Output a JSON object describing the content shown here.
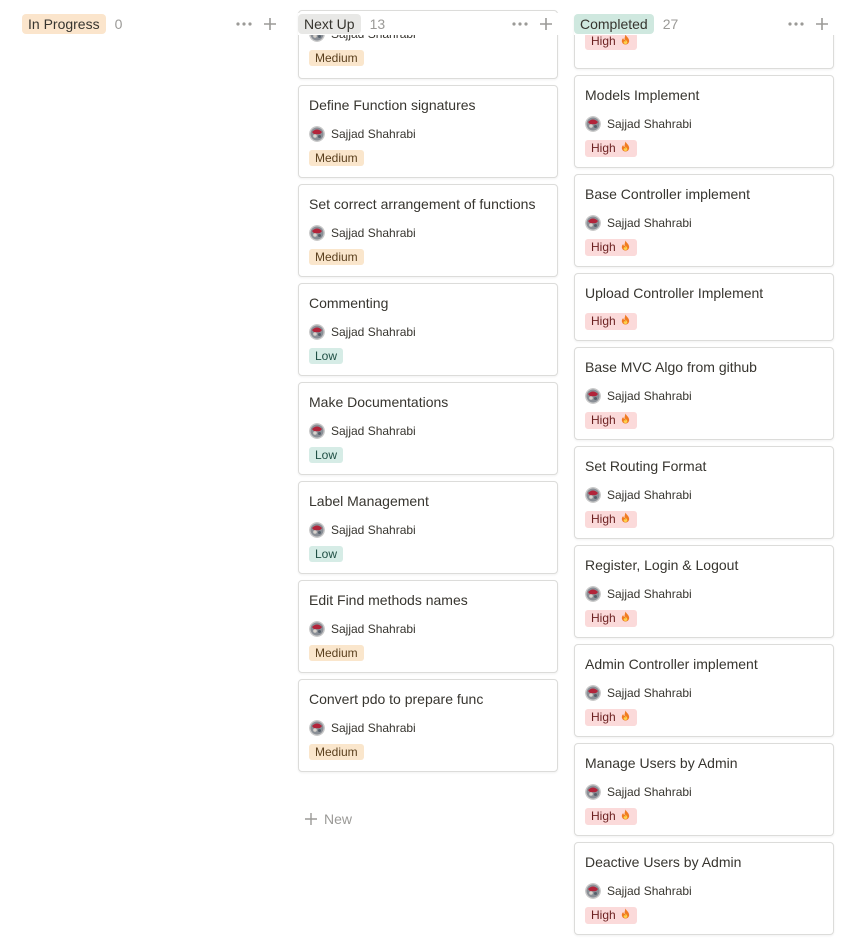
{
  "columns": {
    "in_progress": {
      "title": "In Progress",
      "count": "0",
      "title_bg": "#fbe5cc"
    },
    "next_up": {
      "title": "Next Up",
      "count": "13",
      "title_bg": "#e8e8e6",
      "new_label": "New",
      "cards": [
        {
          "title": "",
          "assignee": "Sajjad Shahrabi",
          "priority": "Medium"
        },
        {
          "title": "Define Function signatures",
          "assignee": "Sajjad Shahrabi",
          "priority": "Medium"
        },
        {
          "title": "Set correct arrangement of functions",
          "assignee": "Sajjad Shahrabi",
          "priority": "Medium"
        },
        {
          "title": "Commenting",
          "assignee": "Sajjad Shahrabi",
          "priority": "Low"
        },
        {
          "title": "Make Documentations",
          "assignee": "Sajjad Shahrabi",
          "priority": "Low"
        },
        {
          "title": "Label Management",
          "assignee": "Sajjad Shahrabi",
          "priority": "Low"
        },
        {
          "title": "Edit Find methods names",
          "assignee": "Sajjad Shahrabi",
          "priority": "Medium"
        },
        {
          "title": "Convert pdo to prepare func",
          "assignee": "Sajjad Shahrabi",
          "priority": "Medium"
        }
      ]
    },
    "completed": {
      "title": "Completed",
      "count": "27",
      "title_bg": "#cfe8df",
      "cards": [
        {
          "title": "",
          "assignee": "",
          "priority": "High"
        },
        {
          "title": "Models Implement",
          "assignee": "Sajjad Shahrabi",
          "priority": "High"
        },
        {
          "title": "Base Controller implement",
          "assignee": "Sajjad Shahrabi",
          "priority": "High"
        },
        {
          "title": "Upload Controller Implement",
          "assignee": "",
          "priority": "High"
        },
        {
          "title": "Base MVC Algo from github",
          "assignee": "Sajjad Shahrabi",
          "priority": "High"
        },
        {
          "title": "Set Routing Format",
          "assignee": "Sajjad Shahrabi",
          "priority": "High"
        },
        {
          "title": "Register, Login & Logout",
          "assignee": "Sajjad Shahrabi",
          "priority": "High"
        },
        {
          "title": "Admin Controller implement",
          "assignee": "Sajjad Shahrabi",
          "priority": "High"
        },
        {
          "title": "Manage Users by Admin",
          "assignee": "Sajjad Shahrabi",
          "priority": "High"
        },
        {
          "title": "Deactive Users by Admin",
          "assignee": "Sajjad Shahrabi",
          "priority": "High"
        }
      ]
    }
  },
  "icons": {
    "more": "more-horizontal-icon",
    "add": "plus-icon",
    "flame": "fire-icon"
  },
  "colors": {
    "medium": "#fae6cc",
    "low": "#d6ece6",
    "high": "#fbdada"
  }
}
